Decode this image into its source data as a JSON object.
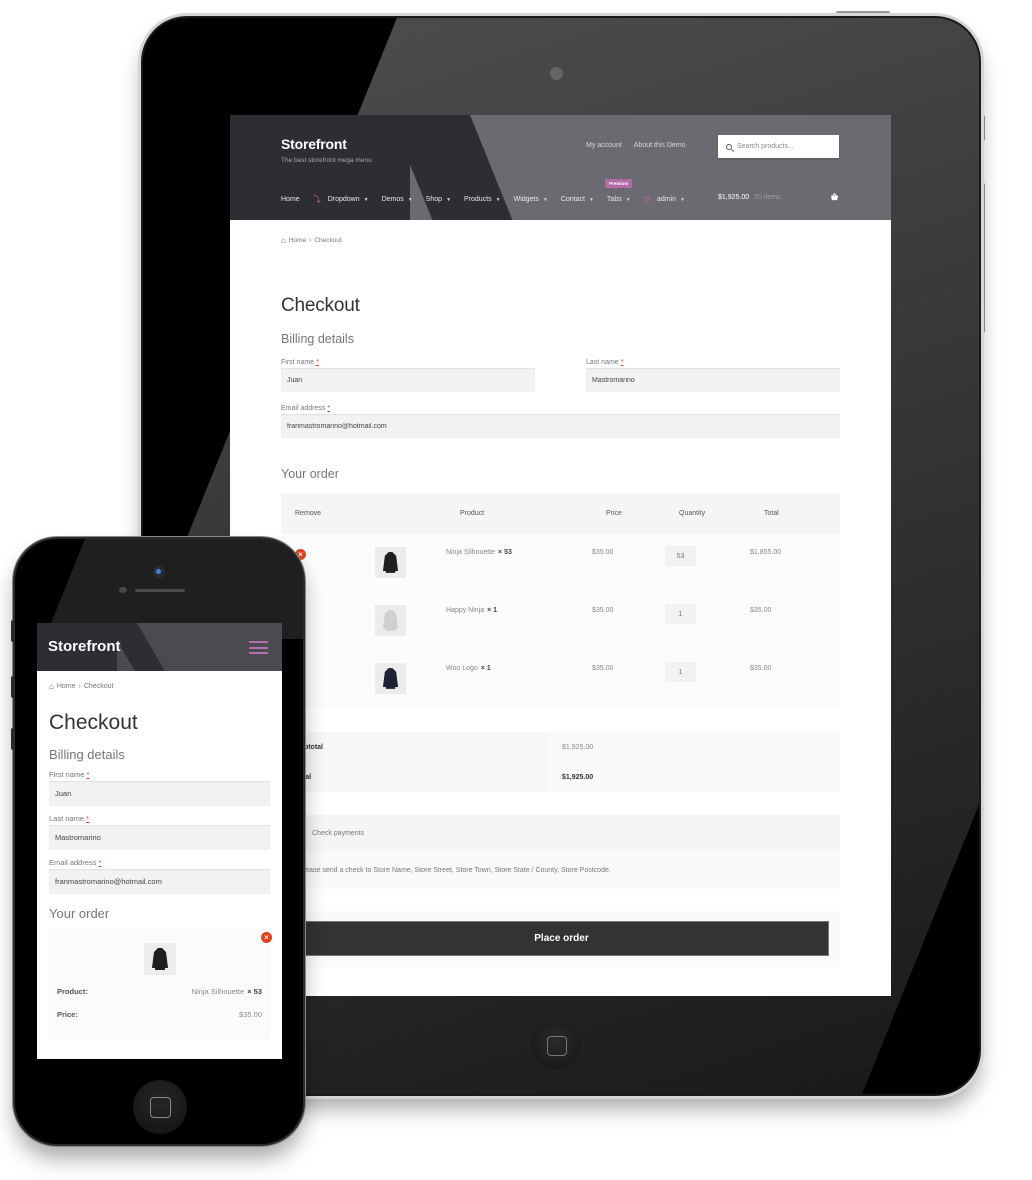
{
  "store": {
    "title": "Storefront",
    "tagline": "The best storefront mega menu"
  },
  "secondary_nav": [
    "My account",
    "About this Demo"
  ],
  "search": {
    "placeholder": "Search products...",
    "icon": "search-icon"
  },
  "primary_nav": [
    {
      "label": "Home",
      "has_caret": false
    },
    {
      "label": "Dropdown",
      "has_caret": true,
      "icon": "link-icon"
    },
    {
      "label": "Demos",
      "has_caret": true
    },
    {
      "label": "Shop",
      "has_caret": true
    },
    {
      "label": "Products",
      "has_caret": true
    },
    {
      "label": "Widgets",
      "has_caret": true
    },
    {
      "label": "Contact",
      "has_caret": true
    },
    {
      "label": "Tabs",
      "has_caret": true,
      "badge": "Premium"
    },
    {
      "label": "admin",
      "has_caret": true,
      "icon": "power-icon"
    }
  ],
  "cart": {
    "amount": "$1,925.00",
    "items": "55 items",
    "icon": "basket-icon"
  },
  "breadcrumb": {
    "home": "Home",
    "separator": "›",
    "current": "Checkout"
  },
  "page_title": "Checkout",
  "billing": {
    "heading": "Billing details",
    "required_mark": "*",
    "first_name": {
      "label": "First name",
      "value": "Juan"
    },
    "last_name": {
      "label": "Last name",
      "value": "Mastromarino"
    },
    "email": {
      "label": "Email address",
      "value": "franmastromarino@hotmail.com"
    }
  },
  "order": {
    "heading": "Your order",
    "columns": [
      "Remove",
      "",
      "Product",
      "Price",
      "Quantity",
      "Total"
    ],
    "rows": [
      {
        "product": "Ninja Silhouette",
        "qty_label": "× 53",
        "price": "$35.00",
        "quantity": "53",
        "total": "$1,855.00",
        "hoodie_color": "#1e1e1e"
      },
      {
        "product": "Happy Ninja",
        "qty_label": "× 1",
        "price": "$35.00",
        "quantity": "1",
        "total": "$35.00",
        "hoodie_color": "#cfcfcf"
      },
      {
        "product": "Woo Logo",
        "qty_label": "× 1",
        "price": "$35.00",
        "quantity": "1",
        "total": "$35.00",
        "hoodie_color": "#1f2233"
      }
    ],
    "subtotal_label": "Subtotal",
    "subtotal": "$1,925.00",
    "total_label": "Total",
    "total": "$1,925.00"
  },
  "payment": {
    "method": "Check payments",
    "description": "Please send a check to Store Name, Store Street, Store Town, Store State / County, Store Postcode."
  },
  "place_order_label": "Place order",
  "mobile": {
    "menu_icon": "hamburger-icon",
    "product_label": "Product:",
    "price_label": "Price:",
    "product": "Ninja Silhouette",
    "qty_label": "× 53",
    "price": "$35.00"
  },
  "colors": {
    "accent": "#b46aa8",
    "remove": "#e2401c",
    "button": "#333333",
    "header_dark": "#2d2d33"
  }
}
